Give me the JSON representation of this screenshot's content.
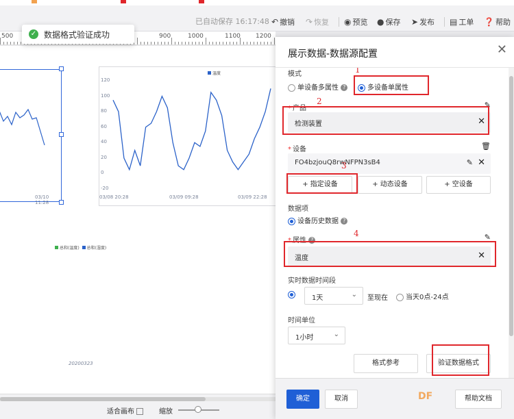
{
  "topbar": {
    "autosave": "已自动保存 16:17:48",
    "undo": "撤销",
    "redo": "恢复",
    "preview": "预览",
    "save": "保存",
    "publish": "发布",
    "ticket": "工单",
    "help": "帮助"
  },
  "ruler": {
    "labels": [
      "500",
      "900",
      "1000",
      "1100",
      "1200"
    ]
  },
  "toast": {
    "message": "数据格式验证成功"
  },
  "canvas": {
    "chart_right_legend": "温度",
    "chart_right_yticks": [
      "120",
      "100",
      "80",
      "60",
      "40",
      "20",
      "0",
      "-20"
    ],
    "chart_right_xticks": [
      "03/08 20:28",
      "03/09 09:28",
      "03/09 22:28"
    ],
    "chart_left_xtick": "03/10 11:28",
    "chart_bottom_legend": [
      "总和(温度)",
      "总和(湿度)"
    ],
    "chart_bottom_label": "20200323",
    "fit_canvas": "适合画布",
    "zoom": "缩放"
  },
  "chart_data": {
    "type": "line",
    "series": [
      {
        "name": "温度",
        "values": [
          95,
          80,
          20,
          5,
          30,
          10,
          60,
          65,
          80,
          100,
          85,
          40,
          10,
          5,
          20,
          40,
          35,
          55,
          105,
          95,
          75,
          30,
          15,
          5,
          15,
          25,
          45,
          60,
          80,
          110
        ]
      }
    ],
    "x": [
      "03/08 20:28",
      "03/09 09:28",
      "03/09 22:28"
    ],
    "ylim": [
      -20,
      120
    ]
  },
  "panel": {
    "title": "展示数据-数据源配置",
    "mode_label": "模式",
    "mode_options": [
      "单设备多属性",
      "多设备单属性"
    ],
    "product_label": "产品",
    "product_value": "检测装置",
    "device_label": "设备",
    "device_value": "FO4bzjouQ8rwNFPN3sB4",
    "device_buttons": [
      "+ 指定设备",
      "+ 动态设备",
      "+ 空设备"
    ],
    "data_item_label": "数据项",
    "data_item_option": "设备历史数据",
    "attribute_label": "属性",
    "attribute_value": "温度",
    "realtime_label": "实时数据时间段",
    "range_value": "1天",
    "to_now": "至现在",
    "today_option": "当天0点-24点",
    "time_unit_label": "时间单位",
    "time_unit_value": "1小时",
    "format_ref": "格式参考",
    "validate": "验证数据格式",
    "confirm": "确定",
    "cancel": "取消",
    "help_docs": "帮助文档",
    "annotations": [
      "1",
      "2",
      "3",
      "4"
    ]
  },
  "colors": {
    "accent": "#1f5fd6",
    "success": "#3fb04e",
    "annotation": "#e0262b",
    "line": "#2b62c9"
  }
}
